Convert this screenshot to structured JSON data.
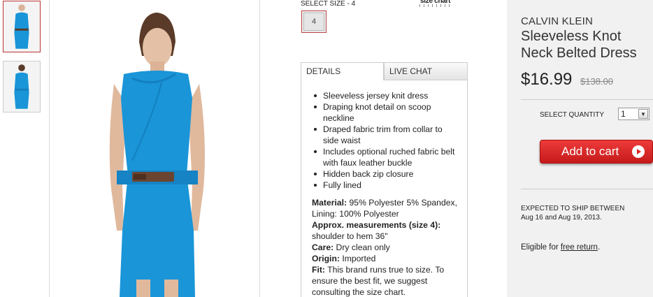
{
  "size": {
    "label": "SELECT SIZE - 4",
    "chart_link": "size chart",
    "options": [
      "4"
    ]
  },
  "tabs": {
    "details": "DETAILS",
    "live_chat": "LIVE CHAT"
  },
  "details": {
    "bullets": [
      "Sleeveless jersey knit dress",
      "Draping knot detail on scoop neckline",
      "Draped fabric trim from collar to side waist",
      "Includes optional ruched fabric belt with faux leather buckle",
      "Hidden back zip closure",
      "Fully lined"
    ],
    "specs": [
      {
        "label": "Material:",
        "value": " 95% Polyester 5% Spandex, Lining: 100% Polyester"
      },
      {
        "label": "Approx. measurements (size 4):",
        "value": " shoulder to hem 36\""
      },
      {
        "label": "Care:",
        "value": " Dry clean only"
      },
      {
        "label": "Origin:",
        "value": " Imported"
      },
      {
        "label": "Fit:",
        "value": " This brand runs true to size. To ensure the best fit, we suggest consulting the size chart."
      }
    ]
  },
  "product": {
    "brand": "CALVIN KLEIN",
    "title": "Sleeveless Knot Neck Belted Dress",
    "price": "$16.99",
    "original_price": "$138.00"
  },
  "quantity": {
    "label": "SELECT QUANTITY",
    "value": "1"
  },
  "cart": {
    "label": "Add to cart"
  },
  "shipping": {
    "line1": "EXPECTED TO SHIP BETWEEN",
    "line2": "Aug 16 and Aug 19, 2013."
  },
  "returns": {
    "prefix": "Eligible for ",
    "link": "free return",
    "suffix": "."
  },
  "colors": {
    "dress": "#1a95d8",
    "cart_button": "#d92323",
    "sidebar_bg": "#f1f1f1"
  }
}
